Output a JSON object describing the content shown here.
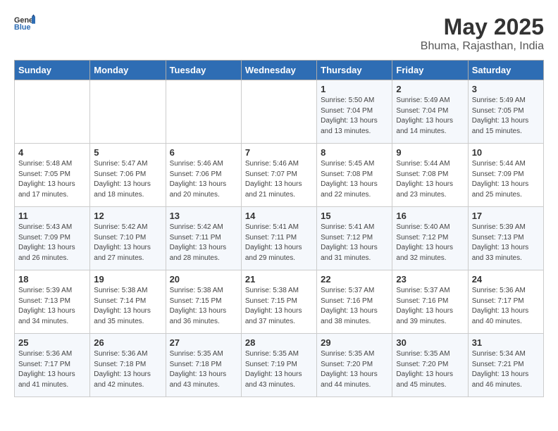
{
  "header": {
    "logo_general": "General",
    "logo_blue": "Blue",
    "month_title": "May 2025",
    "location": "Bhuma, Rajasthan, India"
  },
  "days_of_week": [
    "Sunday",
    "Monday",
    "Tuesday",
    "Wednesday",
    "Thursday",
    "Friday",
    "Saturday"
  ],
  "weeks": [
    [
      {
        "day": "",
        "detail": ""
      },
      {
        "day": "",
        "detail": ""
      },
      {
        "day": "",
        "detail": ""
      },
      {
        "day": "",
        "detail": ""
      },
      {
        "day": "1",
        "detail": "Sunrise: 5:50 AM\nSunset: 7:04 PM\nDaylight: 13 hours\nand 13 minutes."
      },
      {
        "day": "2",
        "detail": "Sunrise: 5:49 AM\nSunset: 7:04 PM\nDaylight: 13 hours\nand 14 minutes."
      },
      {
        "day": "3",
        "detail": "Sunrise: 5:49 AM\nSunset: 7:05 PM\nDaylight: 13 hours\nand 15 minutes."
      }
    ],
    [
      {
        "day": "4",
        "detail": "Sunrise: 5:48 AM\nSunset: 7:05 PM\nDaylight: 13 hours\nand 17 minutes."
      },
      {
        "day": "5",
        "detail": "Sunrise: 5:47 AM\nSunset: 7:06 PM\nDaylight: 13 hours\nand 18 minutes."
      },
      {
        "day": "6",
        "detail": "Sunrise: 5:46 AM\nSunset: 7:06 PM\nDaylight: 13 hours\nand 20 minutes."
      },
      {
        "day": "7",
        "detail": "Sunrise: 5:46 AM\nSunset: 7:07 PM\nDaylight: 13 hours\nand 21 minutes."
      },
      {
        "day": "8",
        "detail": "Sunrise: 5:45 AM\nSunset: 7:08 PM\nDaylight: 13 hours\nand 22 minutes."
      },
      {
        "day": "9",
        "detail": "Sunrise: 5:44 AM\nSunset: 7:08 PM\nDaylight: 13 hours\nand 23 minutes."
      },
      {
        "day": "10",
        "detail": "Sunrise: 5:44 AM\nSunset: 7:09 PM\nDaylight: 13 hours\nand 25 minutes."
      }
    ],
    [
      {
        "day": "11",
        "detail": "Sunrise: 5:43 AM\nSunset: 7:09 PM\nDaylight: 13 hours\nand 26 minutes."
      },
      {
        "day": "12",
        "detail": "Sunrise: 5:42 AM\nSunset: 7:10 PM\nDaylight: 13 hours\nand 27 minutes."
      },
      {
        "day": "13",
        "detail": "Sunrise: 5:42 AM\nSunset: 7:11 PM\nDaylight: 13 hours\nand 28 minutes."
      },
      {
        "day": "14",
        "detail": "Sunrise: 5:41 AM\nSunset: 7:11 PM\nDaylight: 13 hours\nand 29 minutes."
      },
      {
        "day": "15",
        "detail": "Sunrise: 5:41 AM\nSunset: 7:12 PM\nDaylight: 13 hours\nand 31 minutes."
      },
      {
        "day": "16",
        "detail": "Sunrise: 5:40 AM\nSunset: 7:12 PM\nDaylight: 13 hours\nand 32 minutes."
      },
      {
        "day": "17",
        "detail": "Sunrise: 5:39 AM\nSunset: 7:13 PM\nDaylight: 13 hours\nand 33 minutes."
      }
    ],
    [
      {
        "day": "18",
        "detail": "Sunrise: 5:39 AM\nSunset: 7:13 PM\nDaylight: 13 hours\nand 34 minutes."
      },
      {
        "day": "19",
        "detail": "Sunrise: 5:38 AM\nSunset: 7:14 PM\nDaylight: 13 hours\nand 35 minutes."
      },
      {
        "day": "20",
        "detail": "Sunrise: 5:38 AM\nSunset: 7:15 PM\nDaylight: 13 hours\nand 36 minutes."
      },
      {
        "day": "21",
        "detail": "Sunrise: 5:38 AM\nSunset: 7:15 PM\nDaylight: 13 hours\nand 37 minutes."
      },
      {
        "day": "22",
        "detail": "Sunrise: 5:37 AM\nSunset: 7:16 PM\nDaylight: 13 hours\nand 38 minutes."
      },
      {
        "day": "23",
        "detail": "Sunrise: 5:37 AM\nSunset: 7:16 PM\nDaylight: 13 hours\nand 39 minutes."
      },
      {
        "day": "24",
        "detail": "Sunrise: 5:36 AM\nSunset: 7:17 PM\nDaylight: 13 hours\nand 40 minutes."
      }
    ],
    [
      {
        "day": "25",
        "detail": "Sunrise: 5:36 AM\nSunset: 7:17 PM\nDaylight: 13 hours\nand 41 minutes."
      },
      {
        "day": "26",
        "detail": "Sunrise: 5:36 AM\nSunset: 7:18 PM\nDaylight: 13 hours\nand 42 minutes."
      },
      {
        "day": "27",
        "detail": "Sunrise: 5:35 AM\nSunset: 7:18 PM\nDaylight: 13 hours\nand 43 minutes."
      },
      {
        "day": "28",
        "detail": "Sunrise: 5:35 AM\nSunset: 7:19 PM\nDaylight: 13 hours\nand 43 minutes."
      },
      {
        "day": "29",
        "detail": "Sunrise: 5:35 AM\nSunset: 7:20 PM\nDaylight: 13 hours\nand 44 minutes."
      },
      {
        "day": "30",
        "detail": "Sunrise: 5:35 AM\nSunset: 7:20 PM\nDaylight: 13 hours\nand 45 minutes."
      },
      {
        "day": "31",
        "detail": "Sunrise: 5:34 AM\nSunset: 7:21 PM\nDaylight: 13 hours\nand 46 minutes."
      }
    ]
  ]
}
